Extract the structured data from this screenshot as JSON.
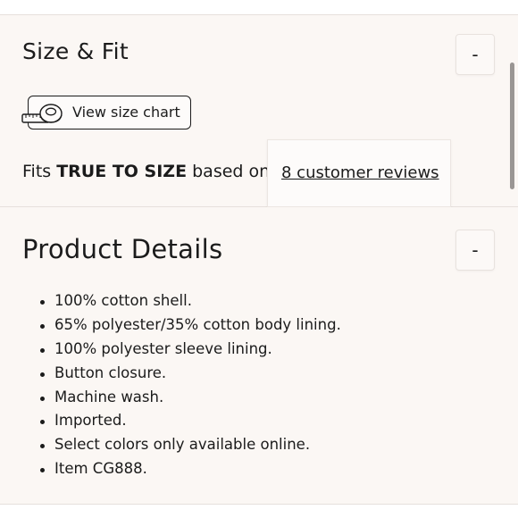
{
  "size_fit": {
    "title": "Size & Fit",
    "toggle_label": "-",
    "size_chart_label": "View size chart",
    "fits_prefix": "Fits ",
    "fits_emphasis": "TRUE TO SIZE",
    "fits_suffix": " based on",
    "reviews_link": "8 customer reviews"
  },
  "product_details": {
    "title": "Product Details",
    "toggle_label": "-",
    "items": [
      "100% cotton shell.",
      "65% polyester/35% cotton body lining.",
      "100% polyester sleeve lining.",
      "Button closure.",
      "Machine wash.",
      "Imported.",
      "Select colors only available online.",
      "Item CG888."
    ]
  },
  "icons": {
    "size_chart": "measuring-tape-icon"
  },
  "colors": {
    "background": "#fbf7f4",
    "text": "#1b1b1b",
    "divider": "#e6e0dc",
    "scrollbar": "#9a9694"
  }
}
